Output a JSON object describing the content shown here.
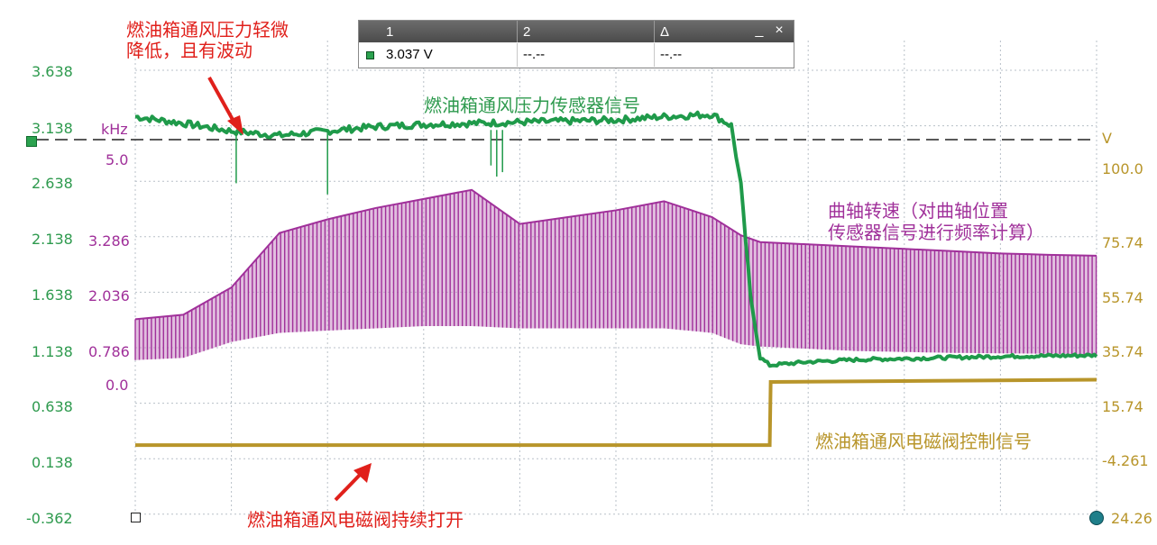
{
  "left_axis_green": {
    "ticks": [
      "3.638",
      "3.138",
      "2.638",
      "2.138",
      "1.638",
      "1.138",
      "0.638",
      "0.138",
      "-0.362"
    ]
  },
  "left_axis_purple": {
    "unit": "kHz",
    "ticks": [
      "5.0",
      "3.286",
      "2.036",
      "0.786",
      "0.0"
    ]
  },
  "right_axis_yellow": {
    "unit": "V",
    "ticks": [
      "100.0",
      "75.74",
      "55.74",
      "35.74",
      "15.74",
      "-4.261",
      "24.26"
    ]
  },
  "annotations": {
    "pressure_drop": "燃油箱通风压力轻微\n降低，且有波动",
    "green_signal": "燃油箱通风压力传感器信号",
    "purple_signal": "曲轴转速（对曲轴位置\n传感器信号进行频率计算）",
    "yellow_signal": "燃油箱通风电磁阀控制信号",
    "valve_open": "燃油箱通风电磁阀持续打开"
  },
  "measurement_panel": {
    "columns": [
      "1",
      "2",
      "Δ"
    ],
    "values": [
      "3.037 V",
      "--.--",
      "--.--"
    ],
    "minimize_label": "_",
    "close_label": "×"
  },
  "colors": {
    "green": "#1f9a4a",
    "purple": "#a0309a",
    "yellow": "#b8952a",
    "red": "#e0201b",
    "grid": "#b8c0c8"
  },
  "chart_data": [
    {
      "type": "line",
      "series": [
        {
          "name": "燃油箱通风压力传感器信号",
          "x": [
            0,
            5,
            10,
            15,
            20,
            25,
            30,
            35,
            40,
            45,
            50,
            55,
            60,
            62,
            63,
            64,
            65,
            66,
            70,
            75,
            80,
            90,
            100
          ],
          "values": [
            3.22,
            3.16,
            3.09,
            3.05,
            3.09,
            3.13,
            3.15,
            3.16,
            3.17,
            3.18,
            3.19,
            3.22,
            3.24,
            3.14,
            2.6,
            1.6,
            1.05,
            0.98,
            1.01,
            1.03,
            1.04,
            1.06,
            1.07
          ]
        },
        {
          "name": "燃油箱通风电磁阀控制信号",
          "x": [
            0,
            66,
            66.1,
            100
          ],
          "values": [
            0.26,
            0.26,
            0.83,
            0.85
          ]
        }
      ],
      "ylim": [
        -0.362,
        3.638
      ]
    },
    {
      "type": "area",
      "series": [
        {
          "name": "曲轴转速",
          "x": [
            0,
            5,
            10,
            15,
            20,
            25,
            30,
            35,
            40,
            45,
            50,
            55,
            60,
            63,
            65,
            70,
            75,
            80,
            85,
            90,
            95,
            100
          ],
          "upper": [
            1.5,
            1.6,
            2.2,
            3.4,
            3.7,
            3.95,
            4.15,
            4.35,
            3.6,
            3.75,
            3.9,
            4.1,
            3.75,
            3.35,
            3.2,
            3.15,
            3.1,
            3.05,
            3.0,
            2.95,
            2.92,
            2.9
          ],
          "lower": [
            0.6,
            0.65,
            1.0,
            1.2,
            1.25,
            1.3,
            1.35,
            1.35,
            1.3,
            1.3,
            1.3,
            1.3,
            1.2,
            0.95,
            0.9,
            0.85,
            0.8,
            0.78,
            0.76,
            0.75,
            0.74,
            0.72
          ]
        }
      ],
      "ylim": [
        0.0,
        5.0
      ]
    }
  ]
}
